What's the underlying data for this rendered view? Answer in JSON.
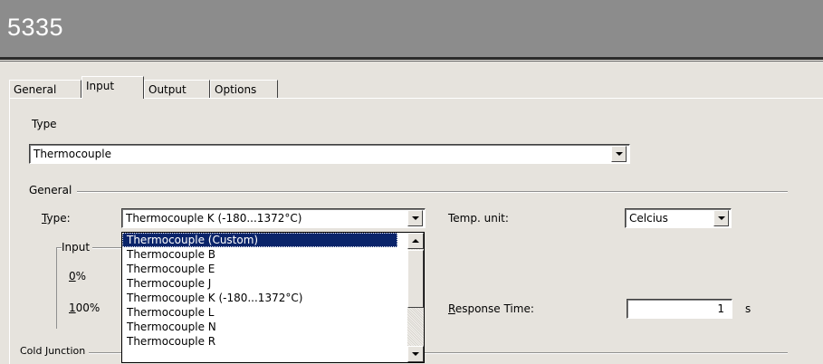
{
  "window": {
    "title": "5335"
  },
  "tabs": [
    {
      "label": "General"
    },
    {
      "label": "Input"
    },
    {
      "label": "Output"
    },
    {
      "label": "Options"
    }
  ],
  "input_tab": {
    "type_section_label": "Type",
    "type_select_value": "Thermocouple",
    "general_group_label": "General",
    "type_label": "Type:",
    "type_accel": "T",
    "type_label_rest": "ype:",
    "sensor_select_value": "Thermocouple K (-180...1372°C)",
    "temp_unit_label": "Temp. unit:",
    "temp_unit_value": "Celcius",
    "input_group_label": "Input",
    "zero_pct_accel": "0",
    "zero_pct_rest": "%",
    "hundred_pct_accel": "1",
    "hundred_pct_rest": "00%",
    "response_time_accel": "R",
    "response_time_rest": "esponse Time:",
    "response_time_value": "1",
    "response_time_unit": "s",
    "cold_junction_label": "Cold Junction"
  },
  "sensor_dropdown": {
    "options": [
      "Thermocouple (Custom)",
      "Thermocouple B",
      "Thermocouple E",
      "Thermocouple J",
      "Thermocouple K (-180...1372°C)",
      "Thermocouple L",
      "Thermocouple N",
      "Thermocouple R"
    ],
    "selected_index": 0
  },
  "icons": {
    "dropdown_arrow": "chevron-down-icon",
    "scroll_up": "scroll-up-arrow-icon",
    "scroll_down": "scroll-down-arrow-icon"
  },
  "colors": {
    "title_bar": "#8c8c8c",
    "dialog_bg": "#e6e3dd",
    "selection": "#0a246a"
  }
}
